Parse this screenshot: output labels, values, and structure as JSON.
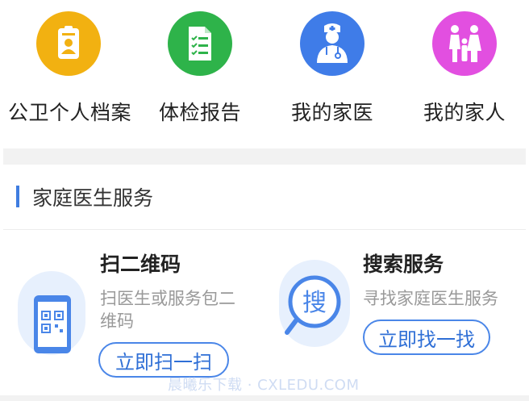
{
  "quick_actions": [
    {
      "label": "公卫个人档案",
      "icon": "health-record-card-icon",
      "color": "#f2b111"
    },
    {
      "label": "体检报告",
      "icon": "checklist-report-icon",
      "color": "#2eb34a"
    },
    {
      "label": "我的家医",
      "icon": "doctor-icon",
      "color": "#3f7ce8"
    },
    {
      "label": "我的家人",
      "icon": "family-icon",
      "color": "#e24fe0"
    }
  ],
  "section": {
    "title": "家庭医生服务",
    "accent_color": "#3f7de0"
  },
  "services": [
    {
      "title": "扫二维码",
      "description": "扫医生或服务包二维码",
      "button": "立即扫一扫",
      "icon": "qr-phone-icon"
    },
    {
      "title": "搜索服务",
      "description": "寻找家庭医生服务",
      "button": "立即找一找",
      "icon": "search-magnifier-icon",
      "icon_char": "搜"
    }
  ],
  "watermark": "晨曦乐下载 · CXLEDU.COM"
}
